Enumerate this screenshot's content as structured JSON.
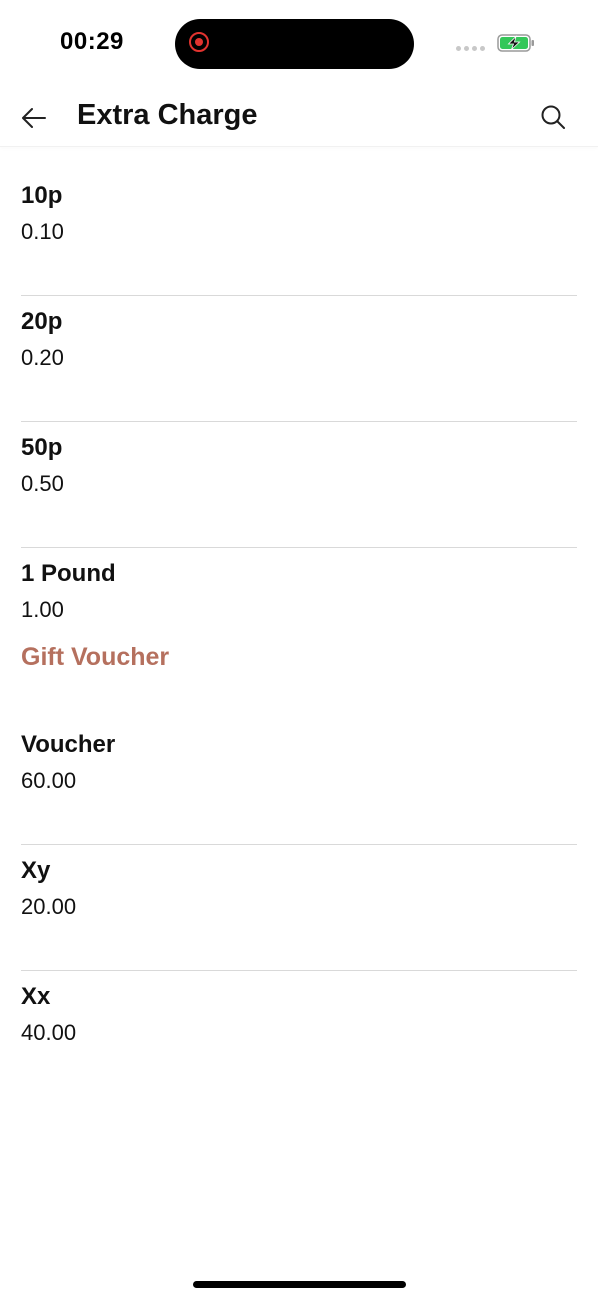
{
  "status_bar": {
    "time": "00:29",
    "battery_state": "charging",
    "recording_indicator": true
  },
  "header": {
    "title": "Extra Charge",
    "back_icon": "arrow-left-icon",
    "search_icon": "search-icon"
  },
  "sections": [
    {
      "title": "",
      "items": [
        {
          "name": "10p",
          "price": "0.10"
        },
        {
          "name": "20p",
          "price": "0.20"
        },
        {
          "name": "50p",
          "price": "0.50"
        },
        {
          "name": "1 Pound",
          "price": "1.00"
        }
      ]
    },
    {
      "title": "Gift Voucher",
      "items": [
        {
          "name": "Voucher",
          "price": "60.00"
        },
        {
          "name": "Xy",
          "price": "20.00"
        },
        {
          "name": "Xx",
          "price": "40.00"
        }
      ]
    }
  ],
  "colors": {
    "section_title": "#b5705e",
    "divider": "#d9d9d9",
    "record": "#e2332f",
    "battery_charging": "#34c759"
  }
}
